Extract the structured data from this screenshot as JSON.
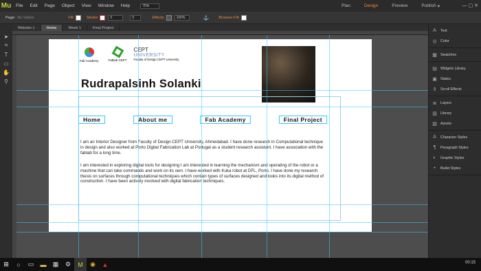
{
  "app": {
    "logo": "Mu",
    "menu": [
      "File",
      "Edit",
      "Page",
      "Object",
      "View",
      "Window",
      "Help"
    ],
    "zoom": "75%",
    "modes": [
      "Plan",
      "Design",
      "Preview",
      "Publish"
    ],
    "active_mode": "Design",
    "publish_arrow": "▾"
  },
  "toolbar": {
    "page_label": "Page:",
    "page_value": "No States",
    "fill_label": "Fill:",
    "stroke_label": "Stroke:",
    "stroke_value": "0",
    "size_value": "0",
    "effects_label": "Effects:",
    "opacity_value": "100%",
    "browser_fill_label": "Browser Fill:"
  },
  "tabs": [
    "Website-1",
    "Home",
    "Week 1",
    "Final Project"
  ],
  "active_tab": "Home",
  "left_tools": [
    "selection-tool-icon",
    "crop-tool-icon",
    "text-tool-icon",
    "rectangle-tool-icon",
    "hand-tool-icon",
    "zoom-tool-icon"
  ],
  "page": {
    "logos": [
      {
        "caption": "Fab Academy"
      },
      {
        "caption": "Fablab CEPT"
      }
    ],
    "cept": {
      "line1": "CEPT",
      "line2": "UNIVERSITY",
      "line3": "Faculty of Design CEPT University"
    },
    "name": "Rudrapalsinh Solanki",
    "nav": [
      "Home",
      "About me",
      "Fab Academy",
      "Final Project"
    ],
    "para1": "I am an Interior Designer from Faculty of Design CEPT University, Ahmedabad. I have done  research in Computational technique in design and also worked at Porto Digital Fabrication Lab at Portugal as a student research assistant. I have association with the fablab for a long time.",
    "para2": "I am interested in exploring digital tools for designing I am interested in learning the mechanism and operating of the robot or a machine that can take commands and work on its own. I have worked with Kuka robot at DFL, Porto. I have done my research thesis on surfaces through computational techniques which contain types of surfaces designed and looks into its digital method of construction. I have been actively involved with digital fabrication techniques."
  },
  "right_panel": [
    [
      {
        "icon": "text-icon",
        "label": "Text"
      },
      {
        "icon": "color-icon",
        "label": "Color"
      }
    ],
    [
      {
        "icon": "swatches-icon",
        "label": "Swatches"
      }
    ],
    [
      {
        "icon": "widgets-icon",
        "label": "Widgets Library"
      },
      {
        "icon": "states-icon",
        "label": "States"
      },
      {
        "icon": "scroll-effects-icon",
        "label": "Scroll Effects"
      }
    ],
    [
      {
        "icon": "layers-icon",
        "label": "Layers"
      },
      {
        "icon": "library-icon",
        "label": "Library"
      },
      {
        "icon": "assets-icon",
        "label": "Assets"
      }
    ],
    [
      {
        "icon": "character-styles-icon",
        "label": "Character Styles"
      },
      {
        "icon": "paragraph-styles-icon",
        "label": "Paragraph Styles"
      },
      {
        "icon": "graphic-styles-icon",
        "label": "Graphic Styles"
      },
      {
        "icon": "bullet-styles-icon",
        "label": "Bullet Styles"
      }
    ]
  ],
  "taskbar": {
    "clock": "00:15"
  }
}
